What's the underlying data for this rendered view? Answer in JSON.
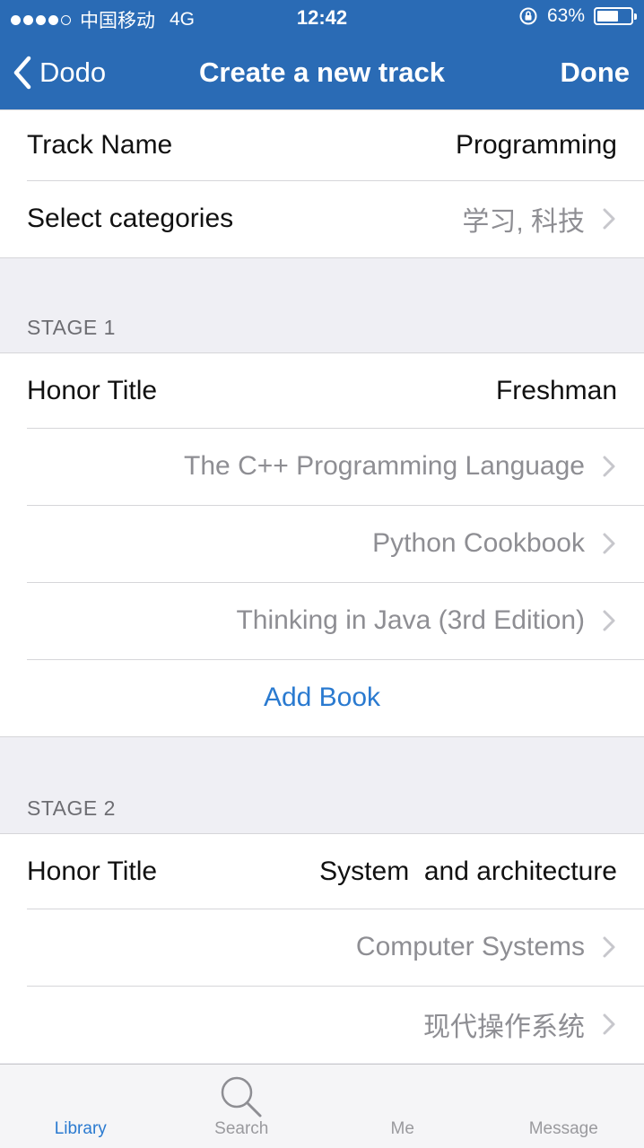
{
  "status_bar": {
    "carrier": "中国移动",
    "network": "4G",
    "time": "12:42",
    "battery_percent": "63%",
    "battery_level": 0.63
  },
  "nav": {
    "back_label": "Dodo",
    "title": "Create a new track",
    "done_label": "Done"
  },
  "track": {
    "name_label": "Track Name",
    "name_value": "Programming",
    "categories_label": "Select categories",
    "categories_value": "学习, 科技"
  },
  "stage1": {
    "header": "STAGE 1",
    "honor_label": "Honor Title",
    "honor_value": "Freshman",
    "books": [
      "The C++ Programming Language",
      "Python Cookbook",
      "Thinking in Java (3rd Edition)"
    ],
    "add_book_label": "Add Book"
  },
  "stage2": {
    "header": "STAGE 2",
    "honor_label": "Honor Title",
    "honor_value": "System  and architecture",
    "books": [
      "Computer Systems",
      "现代操作系统"
    ]
  },
  "tabbar": {
    "tabs": [
      {
        "label": "Library",
        "icon": "library-icon",
        "active": true
      },
      {
        "label": "Search",
        "icon": "search-icon",
        "active": false
      },
      {
        "label": "Me",
        "icon": "me-icon",
        "active": false
      },
      {
        "label": "Message",
        "icon": "message-icon",
        "active": false
      }
    ]
  },
  "colors": {
    "nav_blue": "#2a6bb5",
    "accent_blue": "#2a7ad0",
    "background": "#efeff4"
  }
}
